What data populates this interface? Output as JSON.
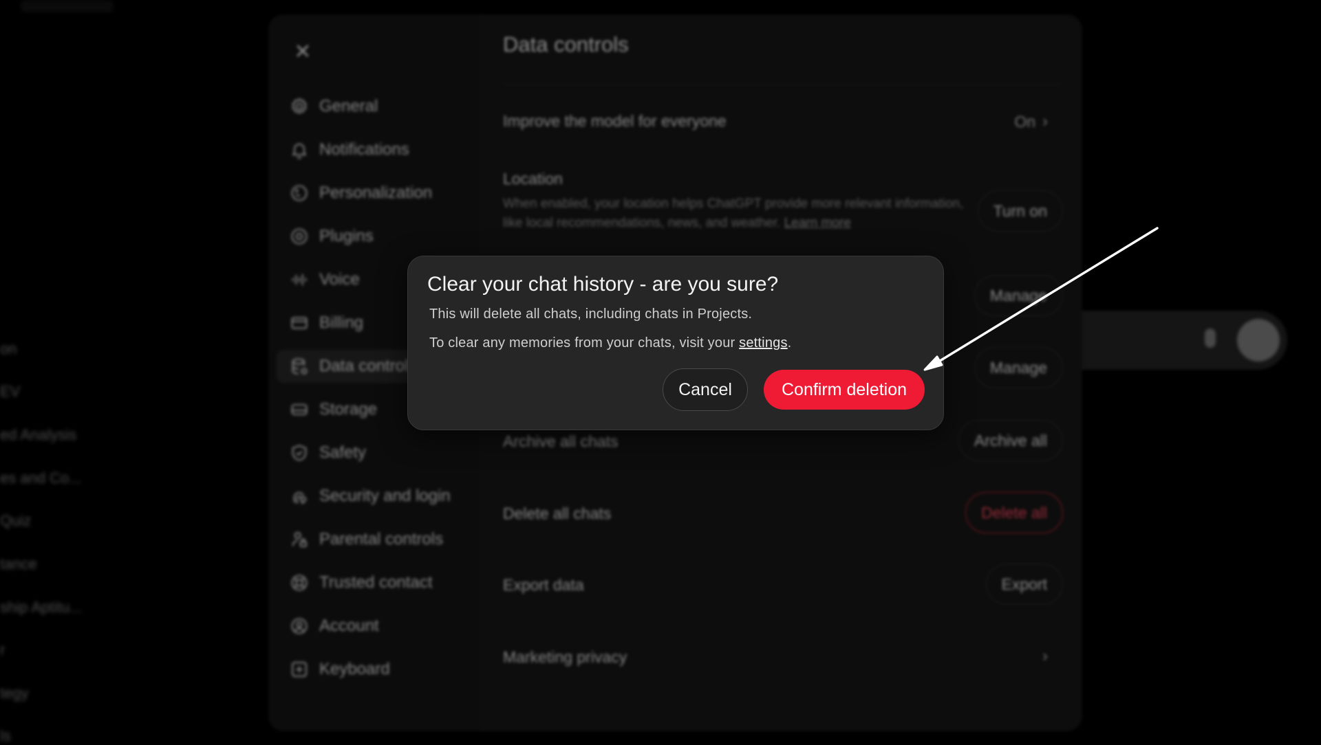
{
  "background_sidebar": {
    "items": [
      "on",
      "EV",
      "ed Analysis",
      "es and Co...",
      "Quiz",
      "tance",
      "ship Aptitu...",
      "r",
      "tegy",
      "ls"
    ]
  },
  "settings": {
    "close_glyph": "✕",
    "nav": [
      {
        "label": "General",
        "icon": "gear-icon"
      },
      {
        "label": "Notifications",
        "icon": "bell-icon"
      },
      {
        "label": "Personalization",
        "icon": "personalization-icon"
      },
      {
        "label": "Plugins",
        "icon": "plugins-icon"
      },
      {
        "label": "Voice",
        "icon": "voice-waveform-icon"
      },
      {
        "label": "Billing",
        "icon": "credit-card-icon"
      },
      {
        "label": "Data controls",
        "icon": "database-icon",
        "active": true
      },
      {
        "label": "Storage",
        "icon": "storage-icon"
      },
      {
        "label": "Safety",
        "icon": "shield-icon"
      },
      {
        "label": "Security and login",
        "icon": "fingerprint-icon"
      },
      {
        "label": "Parental controls",
        "icon": "parental-icon"
      },
      {
        "label": "Trusted contact",
        "icon": "lifebuoy-icon"
      },
      {
        "label": "Account",
        "icon": "user-circle-icon"
      },
      {
        "label": "Keyboard",
        "icon": "keyboard-icon"
      }
    ],
    "panel": {
      "title": "Data controls",
      "improve_label": "Improve the model for everyone",
      "improve_value": "On",
      "location_label": "Location",
      "location_desc": "When enabled, your location helps ChatGPT provide more relevant information, like local recommendations, news, and weather.",
      "location_link": "Learn more",
      "turn_on": "Turn on",
      "manage_1": "Manage",
      "manage_2": "Manage",
      "archive_label": "Archive all chats",
      "archive_btn": "Archive all",
      "delete_label": "Delete all chats",
      "delete_btn": "Delete all",
      "export_label": "Export data",
      "export_btn": "Export",
      "marketing_label": "Marketing privacy"
    }
  },
  "modal": {
    "title": "Clear your chat history - are you sure?",
    "line1": "This will delete all chats, including chats in Projects.",
    "line2_prefix": "To clear any memories from your chats, visit your ",
    "line2_link": "settings",
    "line2_suffix": ".",
    "cancel": "Cancel",
    "confirm": "Confirm deletion"
  },
  "colors": {
    "confirm_bg": "#ef1a34",
    "danger": "#f0455a",
    "modal_bg": "#262626"
  }
}
